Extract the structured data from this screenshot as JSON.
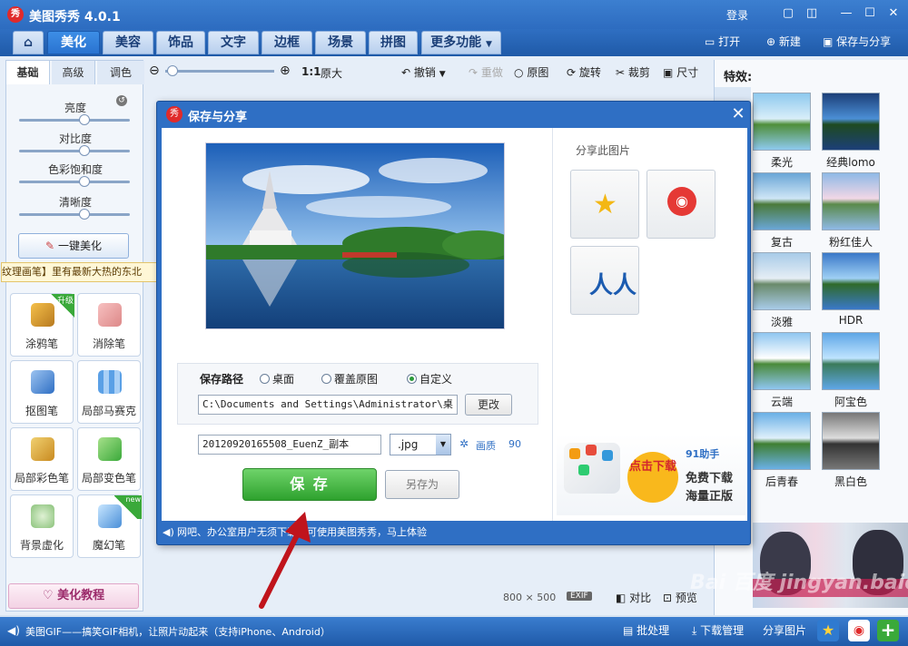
{
  "app": {
    "title": "美图秀秀 4.0.1",
    "logo_text": "秀",
    "login": "登录"
  },
  "tabs": [
    "美化",
    "美容",
    "饰品",
    "文字",
    "边框",
    "场景",
    "拼图",
    "更多功能"
  ],
  "top_actions": {
    "open": "打开",
    "new": "新建",
    "save_share": "保存与分享"
  },
  "left": {
    "subtabs": [
      "基础",
      "高级",
      "调色"
    ],
    "sliders": [
      "亮度",
      "对比度",
      "色彩饱和度",
      "清晰度"
    ],
    "one_click": "一键美化",
    "banner": "纹理画笔】里有最新大热的东北",
    "tools": [
      "涂鸦笔",
      "消除笔",
      "抠图笔",
      "局部马赛克",
      "局部彩色笔",
      "局部变色笔",
      "背景虚化",
      "魔幻笔"
    ],
    "badge_up": "升级",
    "badge_new": "new",
    "tutorial": "美化教程"
  },
  "canvas_toolbar": {
    "ratio": "1:1",
    "original_size": "原大",
    "undo": "撤销",
    "redo": "重做",
    "original": "原图",
    "rotate": "旋转",
    "crop": "裁剪",
    "size": "尺寸"
  },
  "image_info": {
    "dimensions": "800 × 500",
    "exif": "EXIF",
    "compare": "对比",
    "preview": "预览"
  },
  "right": {
    "title": "特效:",
    "effects": [
      "柔光",
      "经典lomo",
      "复古",
      "粉红佳人",
      "淡雅",
      "HDR",
      "云端",
      "阿宝色",
      "后青春",
      "黑白色"
    ]
  },
  "dialog": {
    "title": "保存与分享",
    "logo_text": "秀",
    "share_title": "分享此图片",
    "save_path_label": "保存路径",
    "path_options": [
      "桌面",
      "覆盖原图",
      "自定义"
    ],
    "path_value": "C:\\Documents and Settings\\Administrator\\桌",
    "change_btn": "更改",
    "filename": "20120920165508_EuenZ_副本",
    "format": ".jpg",
    "quality_label": "画质",
    "quality_value": "90",
    "save_btn": "保 存",
    "saveas_btn": "另存为",
    "footer": "网吧、办公室用户无须下载即可使用美图秀秀，马上体验",
    "ad": {
      "badge": "点击下载",
      "brand": "91助手",
      "line1": "免费下载",
      "line2": "海量正版"
    }
  },
  "bottom": {
    "marquee": "美图GIF——搞笑GIF相机，让照片动起来（支持iPhone、Android）",
    "batch": "批处理",
    "download": "下载管理",
    "share": "分享图片"
  },
  "watermark": "Bai 百度 jingyan.baidu.com",
  "colors": {
    "accent": "#2f6fc4",
    "save_green": "#3aa93a",
    "arrow_red": "#c0141c"
  }
}
